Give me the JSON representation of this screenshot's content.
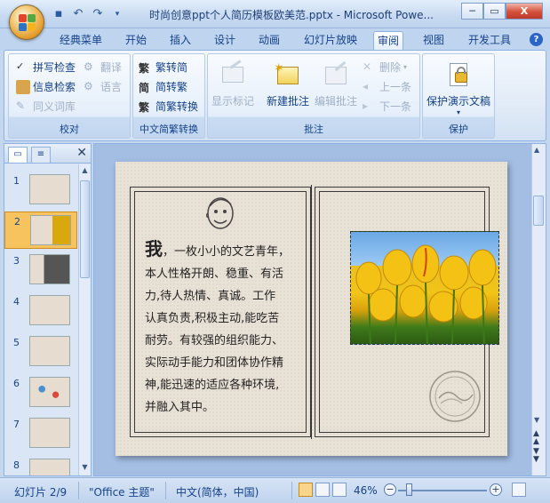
{
  "window": {
    "title": "时尚创意ppt个人简历模板欧美范.pptx - Microsoft Powe...",
    "controls": {
      "minimize": "─",
      "maximize": "▭",
      "close": "X"
    }
  },
  "qat": {
    "save_icon": "save-icon",
    "undo_icon": "undo-icon",
    "redo_icon": "redo-icon",
    "customize_icon": "customize-qat-icon"
  },
  "tabs": [
    {
      "label": "经典菜单"
    },
    {
      "label": "开始"
    },
    {
      "label": "插入"
    },
    {
      "label": "设计"
    },
    {
      "label": "动画"
    },
    {
      "label": "幻灯片放映"
    },
    {
      "label": "审阅",
      "active": true
    },
    {
      "label": "视图"
    },
    {
      "label": "开发工具"
    }
  ],
  "ribbon": {
    "proofing": {
      "label": "校对",
      "spell": "拼写检查",
      "research": "信息检索",
      "thesaurus": "同义词库",
      "translate": "翻译",
      "language": "语言"
    },
    "chinese": {
      "label": "中文简繁转换",
      "to_simplified": "繁转简",
      "to_traditional": "简转繁",
      "convert": "简繁转换"
    },
    "comments": {
      "label": "批注",
      "show_markup": "显示标记",
      "new_comment": "新建批注",
      "edit_comment": "编辑批注",
      "delete": "删除",
      "previous": "上一条",
      "next": "下一条"
    },
    "protect": {
      "label": "保护",
      "protect_presentation": "保护演示文稿"
    }
  },
  "slide_pane": {
    "tab_slides": "▭",
    "tab_outline": "≡",
    "close": "✕",
    "slides": [
      {
        "num": "1"
      },
      {
        "num": "2",
        "selected": true
      },
      {
        "num": "3"
      },
      {
        "num": "4"
      },
      {
        "num": "5"
      },
      {
        "num": "6"
      },
      {
        "num": "7"
      },
      {
        "num": "8"
      }
    ]
  },
  "slide": {
    "big_char": "我",
    "lines": [
      "，一枚小小的文艺青年，",
      "本人性格开朗、稳重、有活",
      "力,待人热情、真诚。工作",
      "认真负责,积极主动,能吃苦",
      "耐劳。有较强的组织能力、",
      "实际动手能力和团体协作精",
      "神,能迅速的适应各种环境,",
      "并融入其中。"
    ]
  },
  "status": {
    "slide_pos": "幻灯片 2/9",
    "theme": "\"Office 主题\"",
    "language": "中文(简体，中国)",
    "zoom": "46%",
    "zoom_fraction": 0.46
  },
  "colors": {
    "ribbon_text": "#15428b",
    "selected_thumb": "#f6c35e"
  }
}
